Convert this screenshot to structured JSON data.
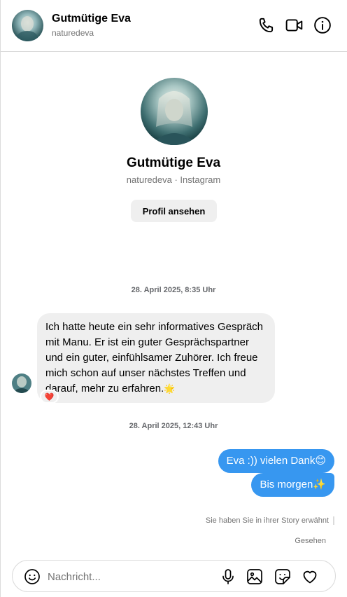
{
  "header": {
    "name": "Gutmütige Eva",
    "username": "naturedeva"
  },
  "profile": {
    "name": "Gutmütige Eva",
    "subtitle": "naturedeva · Instagram",
    "view_profile_label": "Profil ansehen"
  },
  "messages": {
    "timestamp_1": "28. April 2025, 8:35 Uhr",
    "incoming_text": "Ich hatte heute ein sehr informatives Gespräch mit Manu. Er ist ein guter Gesprächspartner und ein guter, einfühlsamer Zuhörer. Ich freue mich schon auf unser nächstes Treffen und darauf, mehr zu erfahren.",
    "incoming_emoji": "🌟",
    "reaction_emoji": "❤️",
    "timestamp_2": "28. April 2025, 12:43 Uhr",
    "outgoing_1": "Eva :)) vielen Dank😊",
    "outgoing_2": "Bis morgen✨",
    "story_note": "Sie haben Sie in ihrer Story erwähnt",
    "seen_label": "Gesehen"
  },
  "composer": {
    "placeholder": "Nachricht..."
  },
  "icons": {
    "header": [
      "phone-icon",
      "video-call-icon",
      "info-icon"
    ],
    "composer": [
      "emoji-icon",
      "microphone-icon",
      "image-icon",
      "sticker-icon",
      "heart-icon"
    ]
  },
  "colors": {
    "accent": "#3797f0",
    "incoming_bubble": "#efefef",
    "muted_text": "#737373",
    "border": "#dbdbdb"
  }
}
